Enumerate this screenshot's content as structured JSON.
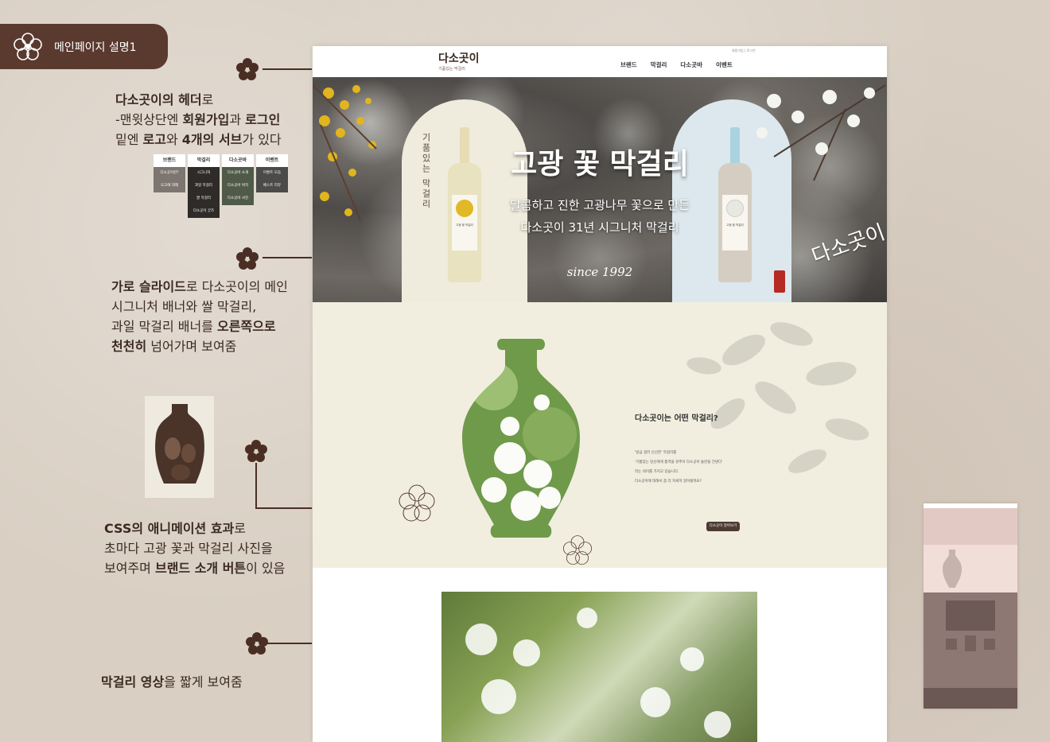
{
  "title_tag": {
    "label": "메인페이지 설명1"
  },
  "notes": {
    "header": {
      "l1_a": "다소곳이의 헤더",
      "l1_b": "로",
      "l2_a": "-맨윗상단엔 ",
      "l2_b": "회원가입",
      "l2_c": "과 ",
      "l2_d": "로그인",
      "l3_a": "밑엔 ",
      "l3_b": "로고",
      "l3_c": "와 ",
      "l3_d": "4개의 서브",
      "l3_e": "가 있다"
    },
    "slide": {
      "l1_a": "가로 슬라이드",
      "l1_b": "로 다소곳이의 메인",
      "l2": "시그니처 배너와 쌀 막걸리,",
      "l3_a": "과일 막걸리 배너를 ",
      "l3_b": "오른쪽으로",
      "l4_a": "천천히",
      "l4_b": " 넘어가며 보여줌"
    },
    "css": {
      "l1_a": "CSS의 애니메이션 효과",
      "l1_b": "로",
      "l2": "초마다 고광 꽃과 막걸리 사진을",
      "l3_a": "보여주며 ",
      "l3_b": "브랜드 소개 버튼",
      "l3_c": "이 있음"
    },
    "video": {
      "l1_a": "막걸리 영상",
      "l1_b": "을 짧게 보여줌"
    }
  },
  "submenu": [
    {
      "head": "브랜드",
      "items": [
        "다소곳이란?",
        "오고에 대해"
      ]
    },
    {
      "head": "막걸리",
      "items": [
        "시그니처",
        "과일 막걸리",
        "쌀 막걸리",
        "다소곳이 굿즈"
      ]
    },
    {
      "head": "다소곳바",
      "items": [
        "다소곳바 소개",
        "다소곳바 위치",
        "다소곳바 사진"
      ]
    },
    {
      "head": "이벤트",
      "items": [
        "이벤트 모음",
        "베스트 리뷰"
      ]
    }
  ],
  "site": {
    "logo": {
      "title": "다소곳이",
      "sub": "기품있는 막걸리"
    },
    "topnav": "회원가입 | 로그인",
    "nav": [
      "브랜드",
      "막걸리",
      "다소곳바",
      "이벤트"
    ],
    "hero": {
      "vertical": "기품있는 막걸리",
      "title": "고광 꽃 막걸리",
      "sub1": "달콤하고 진한 고광나무 꽃으로 만든",
      "sub2": "다소곳이 31년 시그니처 막걸리",
      "since": "since 1992",
      "brush": "다소곳이",
      "bottle1_label": "고광 꽃 막걸리",
      "bottle2_label": "고광 꽃 막걸리"
    },
    "about": {
      "title": "다소곳이는 어떤 막걸리?",
      "line1": "'방금 걸러 신선한' 막걸리를",
      "line2": "'기품있는 당신에게 품격을 갖추어 다소곳이 술잔을 건넨다'",
      "line3": "라는 의미를 가지고 있습니다.",
      "line4": "다소곳이에 대해서 좀 더 자세히 알아볼까요?",
      "button": "다소곳이 알아보기"
    }
  },
  "colors": {
    "paper": "#d9cfc3",
    "brown": "#5a3a2f",
    "cream": "#f1eee0"
  }
}
